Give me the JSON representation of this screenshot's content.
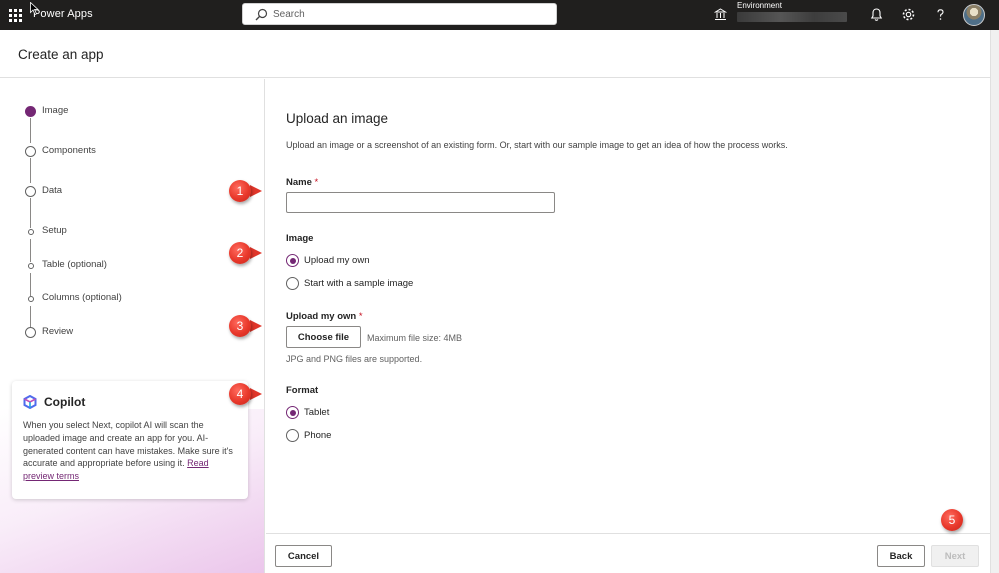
{
  "topbar": {
    "app_name": "Power Apps",
    "search_placeholder": "Search",
    "environment_label": "Environment",
    "icons": [
      "waffle-icon",
      "search-icon",
      "environment-icon",
      "notifications-icon",
      "settings-icon",
      "help-icon",
      "avatar"
    ]
  },
  "header": {
    "title": "Create an app"
  },
  "steps": [
    {
      "label": "Image",
      "state": "active"
    },
    {
      "label": "Components",
      "state": "open"
    },
    {
      "label": "Data",
      "state": "open"
    },
    {
      "label": "Setup",
      "state": "sub"
    },
    {
      "label": "Table (optional)",
      "state": "sub"
    },
    {
      "label": "Columns (optional)",
      "state": "sub"
    },
    {
      "label": "Review",
      "state": "open"
    }
  ],
  "copilot": {
    "title": "Copilot",
    "text": "When you select Next, copilot AI will scan the uploaded image and create an app for you. AI-generated content can have mistakes. Make sure it's accurate and appropriate before using it.",
    "link_text": "Read preview terms"
  },
  "main": {
    "title": "Upload an image",
    "description": "Upload an image or a screenshot of an existing form. Or, start with our sample image to get an idea of how the process works.",
    "name_label": "Name",
    "required_mark": "*",
    "name_value": "",
    "image_label": "Image",
    "image_options": [
      {
        "label": "Upload my own",
        "selected": true
      },
      {
        "label": "Start with a sample image",
        "selected": false
      }
    ],
    "upload_label": "Upload my own",
    "choose_file_label": "Choose file",
    "max_size_text": "Maximum file size: 4MB",
    "supported_text": "JPG and PNG files are supported.",
    "format_label": "Format",
    "format_options": [
      {
        "label": "Tablet",
        "selected": true
      },
      {
        "label": "Phone",
        "selected": false
      }
    ]
  },
  "footer": {
    "cancel_label": "Cancel",
    "back_label": "Back",
    "next_label": "Next"
  },
  "callouts": [
    "1",
    "2",
    "3",
    "4",
    "5"
  ],
  "colors": {
    "accent": "#742774",
    "topbar": "#201f1e",
    "callout": "#e8382b"
  }
}
